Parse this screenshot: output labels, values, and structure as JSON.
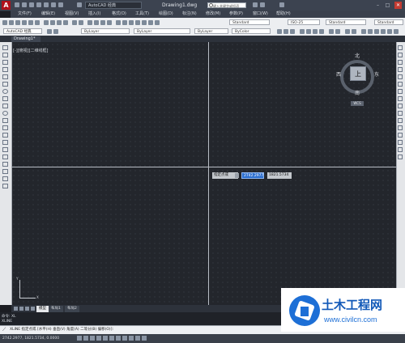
{
  "titlebar": {
    "app_logo": "A",
    "workspace": "AutoCAD 经典",
    "document_title": "Drawing1.dwg",
    "search_placeholder": "键入关键字或短语",
    "minimize": "–",
    "maximize": "□",
    "close": "✕"
  },
  "menubar": {
    "items": [
      "文件(F)",
      "编辑(E)",
      "视图(V)",
      "插入(I)",
      "格式(O)",
      "工具(T)",
      "绘图(D)",
      "标注(N)",
      "修改(M)",
      "参数(P)",
      "窗口(W)",
      "帮助(H)"
    ]
  },
  "toolbar1": {
    "text_style": "Standard",
    "dim_style": "ISO-25",
    "table_style": "Standard",
    "multileader_style": "Standard"
  },
  "toolbar2": {
    "workspace": "AutoCAD 经典",
    "color": "ByLayer",
    "linetype": "ByLayer",
    "lineweight": "ByLayer",
    "plotstyle": "ByColor"
  },
  "file_tab": {
    "label": "Drawing1*"
  },
  "viewport": {
    "label": "[-][俯视][二维线框]"
  },
  "viewcube": {
    "north": "北",
    "south": "南",
    "east": "东",
    "west": "西",
    "face": "上",
    "wcs": "WCS"
  },
  "dynamic_input": {
    "prompt": "指定点或",
    "x_value": "2742.2977",
    "y_value": "1821.5734"
  },
  "ucs": {
    "x": "X",
    "y": "Y"
  },
  "layout_tabs": {
    "model": "模型",
    "layout1": "布局1",
    "layout2": "布局2"
  },
  "command": {
    "history": [
      "命令: XL",
      "XLINE"
    ],
    "icon": "⟋",
    "current": "XLINE 指定点或 [水平(H) 垂直(V) 角度(A) 二等分(B) 偏移(O)]:"
  },
  "statusbar": {
    "coords": "2742.2977, 1821.5734, 0.0000"
  },
  "watermark": {
    "title": "土木工程网",
    "url": "www.civilcn.com"
  },
  "colors": {
    "canvas": "#23262c",
    "title_bar": "#3c4350",
    "selection_blue": "#2d6fcf",
    "app_red": "#b0111b",
    "watermark_blue": "#1d6fd6"
  }
}
